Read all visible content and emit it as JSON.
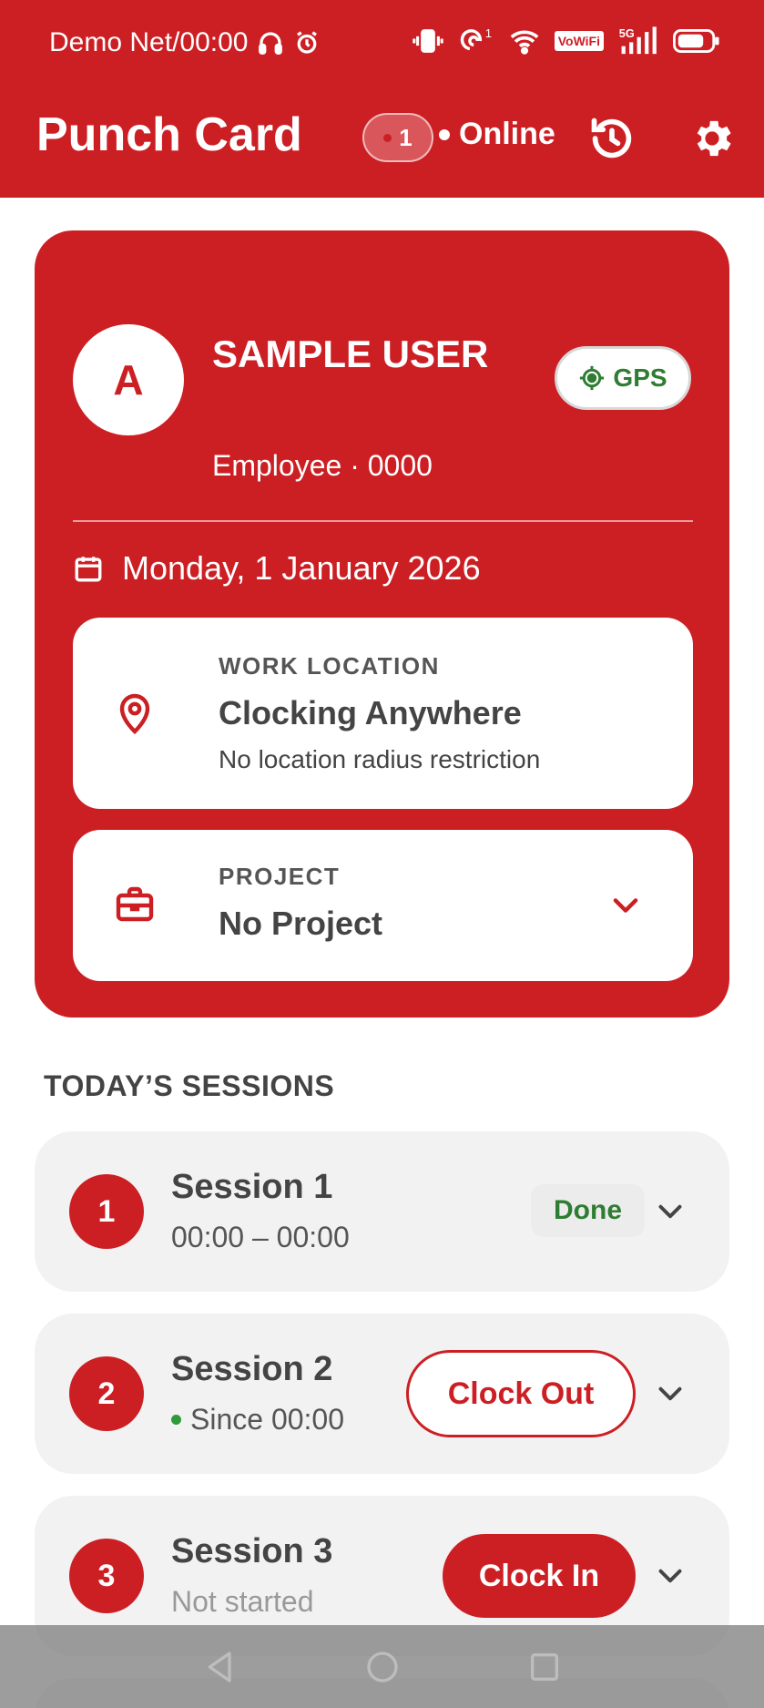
{
  "status_bar": {
    "carrier_time": "Demo Net/00:00",
    "vowifi": "VoWiFi",
    "network": "5G"
  },
  "header": {
    "title": "Punch Card",
    "pending_count": "1",
    "connection_status": "Online"
  },
  "profile": {
    "avatar_initial": "A",
    "name": "SAMPLE USER",
    "subtitle": "Employee · 0000",
    "gps_label": "GPS",
    "date": "Monday, 1 January 2026"
  },
  "work_location": {
    "label": "WORK LOCATION",
    "title": "Clocking Anywhere",
    "description": "No location radius restriction"
  },
  "project": {
    "label": "PROJECT",
    "value": "No Project"
  },
  "sessions": {
    "heading": "TODAY’S SESSIONS",
    "items": [
      {
        "number": "1",
        "title": "Session 1",
        "subtitle": "00:00 – 00:00",
        "status": "Done"
      },
      {
        "number": "2",
        "title": "Session 2",
        "subtitle": "Since 00:00",
        "action": "Clock Out"
      },
      {
        "number": "3",
        "title": "Session 3",
        "subtitle": "Not started",
        "action": "Clock In"
      }
    ]
  },
  "colors": {
    "brand_red": "#cc1f24",
    "success_green": "#2f7d32",
    "card_grey": "#f2f2f2"
  },
  "icons": [
    "headphones-icon",
    "alarm-icon",
    "vibrate-icon",
    "hotspot-icon",
    "wifi-icon",
    "signal-icon",
    "battery-icon",
    "history-icon",
    "gear-icon",
    "crosshair-icon",
    "calendar-icon",
    "map-pin-icon",
    "briefcase-icon",
    "chevron-down-icon",
    "back-icon",
    "home-icon",
    "recents-icon"
  ]
}
